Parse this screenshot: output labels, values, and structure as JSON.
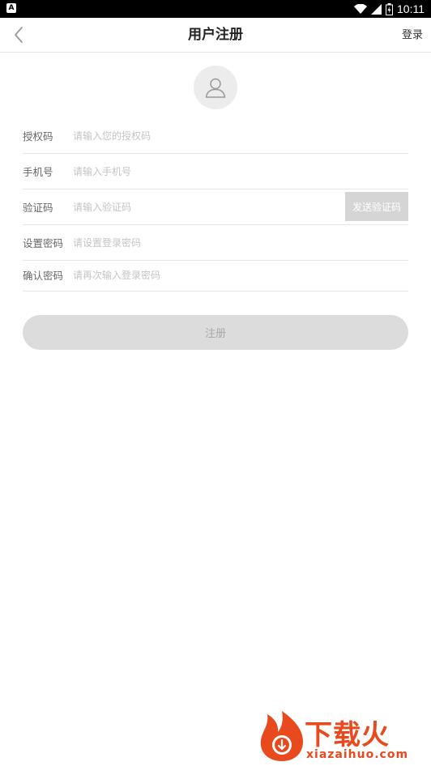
{
  "status_bar": {
    "notification_icon": "app-notification-icon",
    "time": "10:11",
    "icons": [
      "wifi-icon",
      "signal-icon",
      "battery-icon"
    ]
  },
  "nav": {
    "title": "用户注册",
    "login_label": "登录",
    "back_icon": "chevron-left-icon"
  },
  "avatar": {
    "icon": "user-icon"
  },
  "form": {
    "rows": [
      {
        "label": "授权码",
        "placeholder": "请输入您的授权码"
      },
      {
        "label": "手机号",
        "placeholder": "请输入手机号"
      },
      {
        "label": "验证码",
        "placeholder": "请输入验证码"
      },
      {
        "label": "设置密码",
        "placeholder": "请设置登录密码"
      },
      {
        "label": "确认密码",
        "placeholder": "请再次输入登录密码"
      }
    ],
    "send_code_label": "发送验证码"
  },
  "register_label": "注册",
  "watermark": {
    "brand": "下载火",
    "domain": "xiazaihuo.com"
  },
  "colors": {
    "accent_watermark": "#e8491d",
    "button_disabled": "#dcdcdc",
    "divider": "#e6e6e6"
  }
}
